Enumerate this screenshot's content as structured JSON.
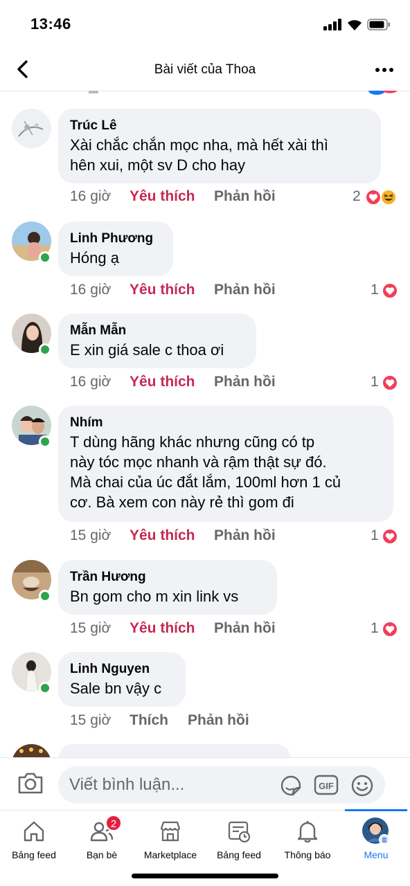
{
  "status_bar": {
    "time": "13:46"
  },
  "header": {
    "title": "Bài viết của Thoa"
  },
  "comments": [
    {
      "name": "Trúc Lê",
      "text": "Xài chắc chắn mọc nha, mà hết xài thì\nhên xui, một sv D cho hay",
      "time": "16 giờ",
      "like": "Yêu thích",
      "reply": "Phản hồi",
      "reaction_count": "2",
      "online": false
    },
    {
      "name": "Linh Phương",
      "text": "Hóng ạ",
      "time": "16 giờ",
      "like": "Yêu thích",
      "reply": "Phản hồi",
      "reaction_count": "1",
      "online": true
    },
    {
      "name": "Mẫn Mẫn",
      "text": "E xin giá sale c thoa ơi",
      "time": "16 giờ",
      "like": "Yêu thích",
      "reply": "Phản hồi",
      "reaction_count": "1",
      "online": true
    },
    {
      "name": "Nhím",
      "text": "T dùng hãng khác nhưng cũng có tp\nnày tóc mọc nhanh và rậm thật sự đó.\nMà chai của úc đắt lắm, 100ml hơn 1 củ\ncơ. Bà xem con này rẻ thì gom đi",
      "time": "15 giờ",
      "like": "Yêu thích",
      "reply": "Phản hồi",
      "reaction_count": "1",
      "online": true
    },
    {
      "name": "Trần Hương",
      "text": "Bn gom cho m xin link vs",
      "time": "15 giờ",
      "like": "Yêu thích",
      "reply": "Phản hồi",
      "reaction_count": "1",
      "online": true
    },
    {
      "name": "Linh Nguyen",
      "text": "Sale bn vậy c",
      "time": "15 giờ",
      "like": "Thích",
      "reply": "Phản hồi",
      "reaction_count": "",
      "online": true
    }
  ],
  "composer": {
    "placeholder": "Viết bình luận..."
  },
  "nav": [
    {
      "label": "Bảng feed",
      "icon": "home-icon"
    },
    {
      "label": "Bạn bè",
      "icon": "friends-icon",
      "badge": "2"
    },
    {
      "label": "Marketplace",
      "icon": "marketplace-icon"
    },
    {
      "label": "Bảng feed",
      "icon": "feed-icon"
    },
    {
      "label": "Thông báo",
      "icon": "bell-icon"
    },
    {
      "label": "Menu",
      "icon": "menu-avatar-icon"
    }
  ],
  "colors": {
    "love_red": "#c42a55",
    "bubble": "#f0f2f5",
    "online": "#31a24c",
    "accent": "#1877f2"
  }
}
